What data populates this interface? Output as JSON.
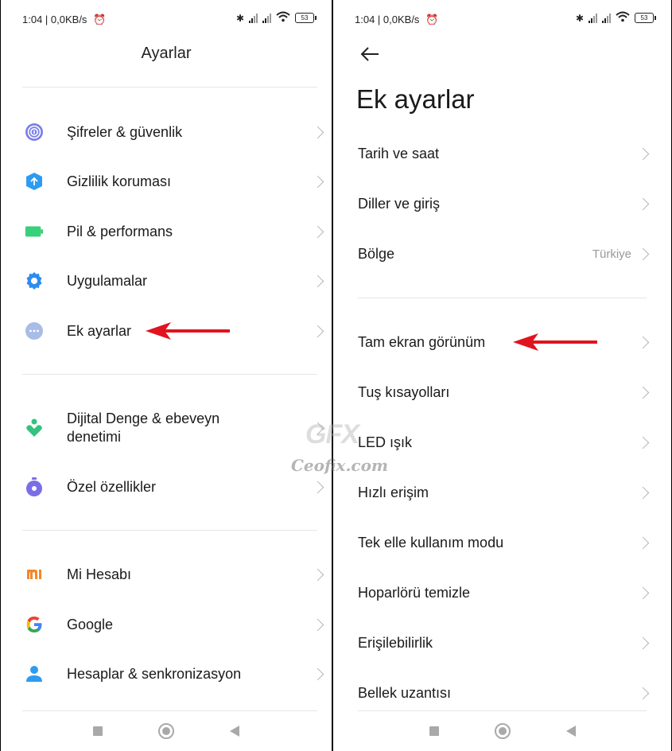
{
  "left": {
    "status": {
      "time": "1:04 | 0,0KB/s",
      "battery": "53"
    },
    "title": "Ayarlar",
    "groups": [
      [
        {
          "label": "Şifreler & güvenlik",
          "icon": "fingerprint-icon"
        },
        {
          "label": "Gizlilik koruması",
          "icon": "privacy-shield-icon"
        },
        {
          "label": "Pil & performans",
          "icon": "battery-icon"
        },
        {
          "label": "Uygulamalar",
          "icon": "apps-gear-icon"
        },
        {
          "label": "Ek ayarlar",
          "icon": "more-dots-icon"
        }
      ],
      [
        {
          "label": "Dijital Denge & ebeveyn denetimi",
          "icon": "digital-wellbeing-icon"
        },
        {
          "label": "Özel özellikler",
          "icon": "special-features-icon"
        }
      ],
      [
        {
          "label": "Mi Hesabı",
          "icon": "mi-logo-icon"
        },
        {
          "label": "Google",
          "icon": "google-g-icon"
        },
        {
          "label": "Hesaplar & senkronizasyon",
          "icon": "account-person-icon"
        }
      ]
    ]
  },
  "right": {
    "status": {
      "time": "1:04 | 0,0KB/s",
      "battery": "53"
    },
    "title": "Ek ayarlar",
    "group1": [
      {
        "label": "Tarih ve saat"
      },
      {
        "label": "Diller ve giriş"
      },
      {
        "label": "Bölge",
        "value": "Türkiye"
      }
    ],
    "group2": [
      {
        "label": "Tam ekran görünüm"
      },
      {
        "label": "Tuş kısayolları"
      },
      {
        "label": "LED ışık"
      },
      {
        "label": "Hızlı erişim"
      },
      {
        "label": "Tek elle kullanım modu"
      },
      {
        "label": "Hoparlörü temizle"
      },
      {
        "label": "Erişilebilirlik"
      },
      {
        "label": "Bellek uzantısı"
      }
    ]
  },
  "watermark": {
    "logo": "GFX",
    "site": "Ceofix.com"
  },
  "colors": {
    "annotation_arrow": "#e0141e",
    "chevron": "#b4b4b4",
    "value_text": "#9a9a9a"
  }
}
